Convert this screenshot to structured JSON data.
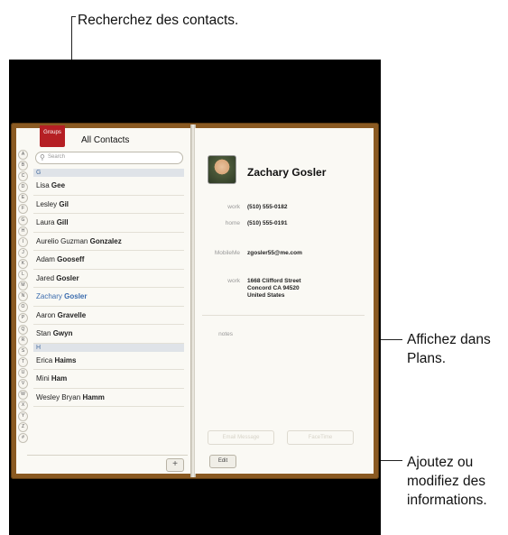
{
  "callouts": {
    "search": "Recherchez des contacts.",
    "maps_line1": "Affichez dans",
    "maps_line2": "Plans.",
    "edit_line1": "Ajoutez ou",
    "edit_line2": "modifiez des",
    "edit_line3": "informations."
  },
  "left_page": {
    "groups_label": "Groups",
    "title": "All Contacts",
    "search_placeholder": "Search",
    "index_letters": [
      "A",
      "B",
      "C",
      "D",
      "E",
      "F",
      "G",
      "H",
      "I",
      "J",
      "K",
      "L",
      "M",
      "N",
      "O",
      "P",
      "Q",
      "R",
      "S",
      "T",
      "U",
      "V",
      "W",
      "X",
      "Y",
      "Z",
      "#"
    ],
    "sections": [
      {
        "header": "G",
        "rows": [
          {
            "first": "Lisa",
            "last": "Gee"
          },
          {
            "first": "Lesley",
            "last": "Gil"
          },
          {
            "first": "Laura",
            "last": "Gill"
          },
          {
            "first": "Aurelio Guzman",
            "last": "Gonzalez"
          },
          {
            "first": "Adam",
            "last": "Gooseff"
          },
          {
            "first": "Jared",
            "last": "Gosler"
          },
          {
            "first": "Zachary",
            "last": "Gosler",
            "selected": true
          },
          {
            "first": "Aaron",
            "last": "Gravelle"
          },
          {
            "first": "Stan",
            "last": "Gwyn"
          }
        ]
      },
      {
        "header": "H",
        "rows": [
          {
            "first": "Erica",
            "last": "Haims"
          },
          {
            "first": "Mini",
            "last": "Ham"
          },
          {
            "first": "Wesley Bryan",
            "last": "Hamm"
          }
        ]
      }
    ],
    "add_label": "+"
  },
  "right_page": {
    "name": "Zachary Gosler",
    "fields": {
      "work_phone": {
        "label": "work",
        "value": "(510) 555-0182"
      },
      "home_phone": {
        "label": "home",
        "value": "(510) 555-0191"
      },
      "mobileme": {
        "label": "MobileMe",
        "value": "zgosler55@me.com"
      },
      "work_address": {
        "label": "work",
        "line1": "1668 Clifford Street",
        "line2": "Concord CA 94520",
        "line3": "United States"
      },
      "notes": {
        "label": "notes"
      }
    },
    "email_button": "Email Message",
    "facetime_button": "FaceTime",
    "edit_label": "Edit"
  },
  "colors": {
    "leather": "#8a5a22",
    "groups_ribbon": "#b51f24",
    "selected_text": "#3b6cae",
    "section_header_bg": "#dfe3e8"
  }
}
